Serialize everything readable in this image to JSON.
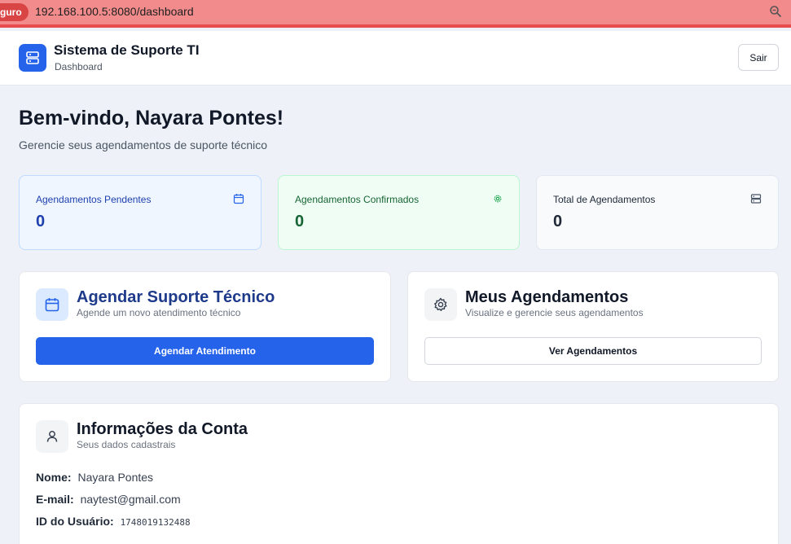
{
  "browser": {
    "insecure_label": "guro",
    "url": "192.168.100.5:8080/dashboard",
    "zoom_icon": "zoom-icon"
  },
  "header": {
    "title": "Sistema de Suporte TI",
    "subtitle": "Dashboard",
    "logout_label": "Sair",
    "logo_icon": "server-icon"
  },
  "welcome": {
    "title": "Bem-vindo, Nayara Pontes!",
    "subtitle": "Gerencie seus agendamentos de suporte técnico"
  },
  "stats": [
    {
      "label": "Agendamentos Pendentes",
      "value": "0",
      "icon": "calendar-icon",
      "color": "#1e40af"
    },
    {
      "label": "Agendamentos Confirmados",
      "value": "0",
      "icon": "gear-icon",
      "color": "#166534"
    },
    {
      "label": "Total de Agendamentos",
      "value": "0",
      "icon": "server-icon",
      "color": "#1f2937"
    }
  ],
  "schedule_card": {
    "title": "Agendar Suporte Técnico",
    "subtitle": "Agende um novo atendimento técnico",
    "button": "Agendar Atendimento",
    "icon": "calendar-icon"
  },
  "mine_card": {
    "title": "Meus Agendamentos",
    "subtitle": "Visualize e gerencie seus agendamentos",
    "button": "Ver Agendamentos",
    "icon": "gear-icon"
  },
  "account": {
    "title": "Informações da Conta",
    "subtitle": "Seus dados cadastrais",
    "icon": "user-icon",
    "name_label": "Nome:",
    "name": "Nayara Pontes",
    "email_label": "E-mail:",
    "email": "naytest@gmail.com",
    "id_label": "ID do Usuário:",
    "id": "1748019132488"
  },
  "colors": {
    "primary": "#2563eb",
    "urlbar": "#f28b8b",
    "insecure": "#d94545"
  }
}
